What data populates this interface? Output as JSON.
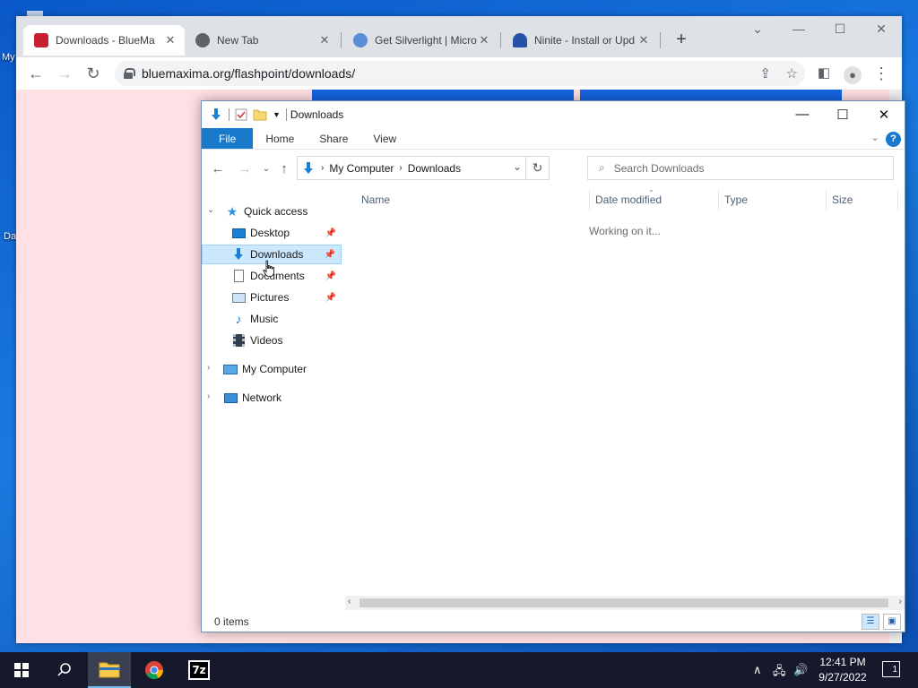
{
  "desktop": {
    "labels": [
      "My",
      "Da"
    ]
  },
  "chrome": {
    "tabs": [
      {
        "title": "Downloads - BlueMa",
        "favicon_color": "#c8202f",
        "active": true
      },
      {
        "title": "New Tab",
        "favicon_color": "#5f6368",
        "active": false
      },
      {
        "title": "Get Silverlight | Micro",
        "favicon_color": "#5a8ed6",
        "active": false
      },
      {
        "title": "Ninite - Install or Upd",
        "favicon_color": "#2852a8",
        "active": false
      }
    ],
    "new_tab_symbol": "+",
    "url": "bluemaxima.org/flashpoint/downloads/"
  },
  "explorer": {
    "title": "Downloads",
    "ribbon_tabs": [
      "File",
      "Home",
      "Share",
      "View"
    ],
    "breadcrumb": [
      "My Computer",
      "Downloads"
    ],
    "search_placeholder": "Search Downloads",
    "nav": {
      "quick_access": "Quick access",
      "items": [
        {
          "label": "Desktop",
          "icon": "desktop-icon",
          "pinned": true
        },
        {
          "label": "Downloads",
          "icon": "downloads-icon",
          "pinned": true,
          "selected": true
        },
        {
          "label": "Documents",
          "icon": "documents-icon",
          "pinned": true
        },
        {
          "label": "Pictures",
          "icon": "pictures-icon",
          "pinned": true
        },
        {
          "label": "Music",
          "icon": "music-icon",
          "pinned": false
        },
        {
          "label": "Videos",
          "icon": "videos-icon",
          "pinned": false
        }
      ],
      "my_computer": "My Computer",
      "network": "Network"
    },
    "columns": [
      "Name",
      "Date modified",
      "Type",
      "Size"
    ],
    "status_message": "Working on it...",
    "item_count": "0 items"
  },
  "taskbar": {
    "time": "12:41 PM",
    "date": "9/27/2022",
    "notification_count": "1",
    "apps": [
      "file-explorer",
      "chrome",
      "7zip"
    ],
    "sevenzip_label": "7z"
  }
}
